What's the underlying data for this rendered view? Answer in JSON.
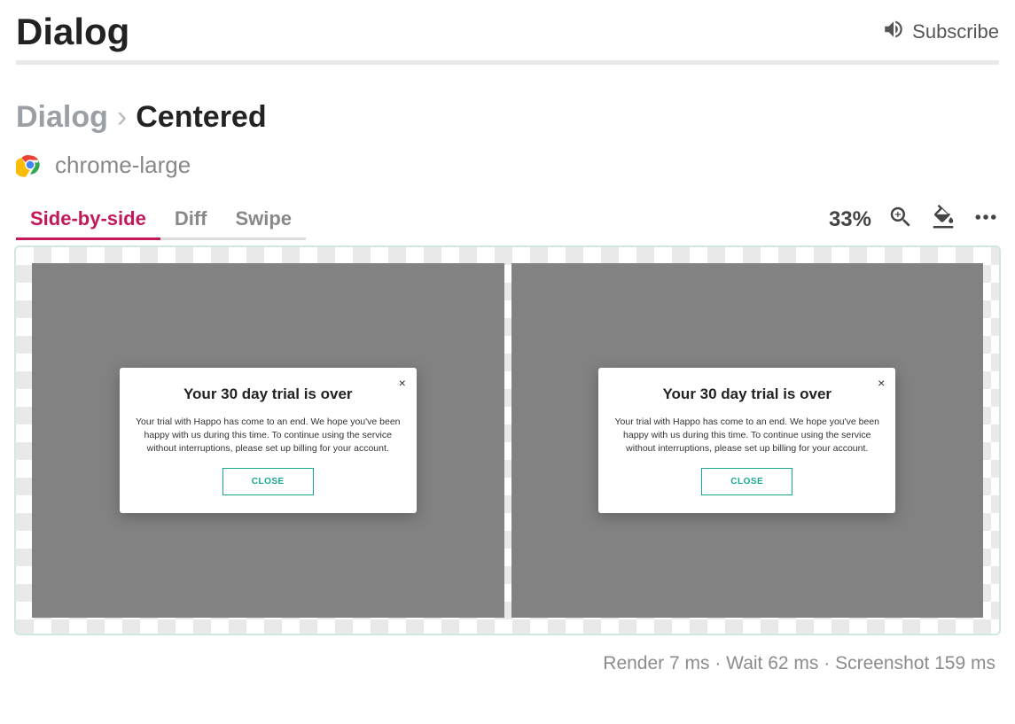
{
  "header": {
    "title": "Dialog",
    "subscribe_label": "Subscribe"
  },
  "breadcrumb": {
    "parent": "Dialog",
    "separator": "›",
    "current": "Centered"
  },
  "target": {
    "label": "chrome-large"
  },
  "tabs": {
    "side_by_side": "Side-by-side",
    "diff": "Diff",
    "swipe": "Swipe"
  },
  "toolbar": {
    "zoom": "33%"
  },
  "dialog": {
    "title": "Your 30 day trial is over",
    "body": "Your trial with Happo has come to an end. We hope you've been happy with us during this time. To continue using the service without interruptions, please set up billing for your account.",
    "close_label": "CLOSE",
    "x": "×"
  },
  "stats": {
    "text": "Render 7 ms · Wait 62 ms · Screenshot 159 ms"
  }
}
